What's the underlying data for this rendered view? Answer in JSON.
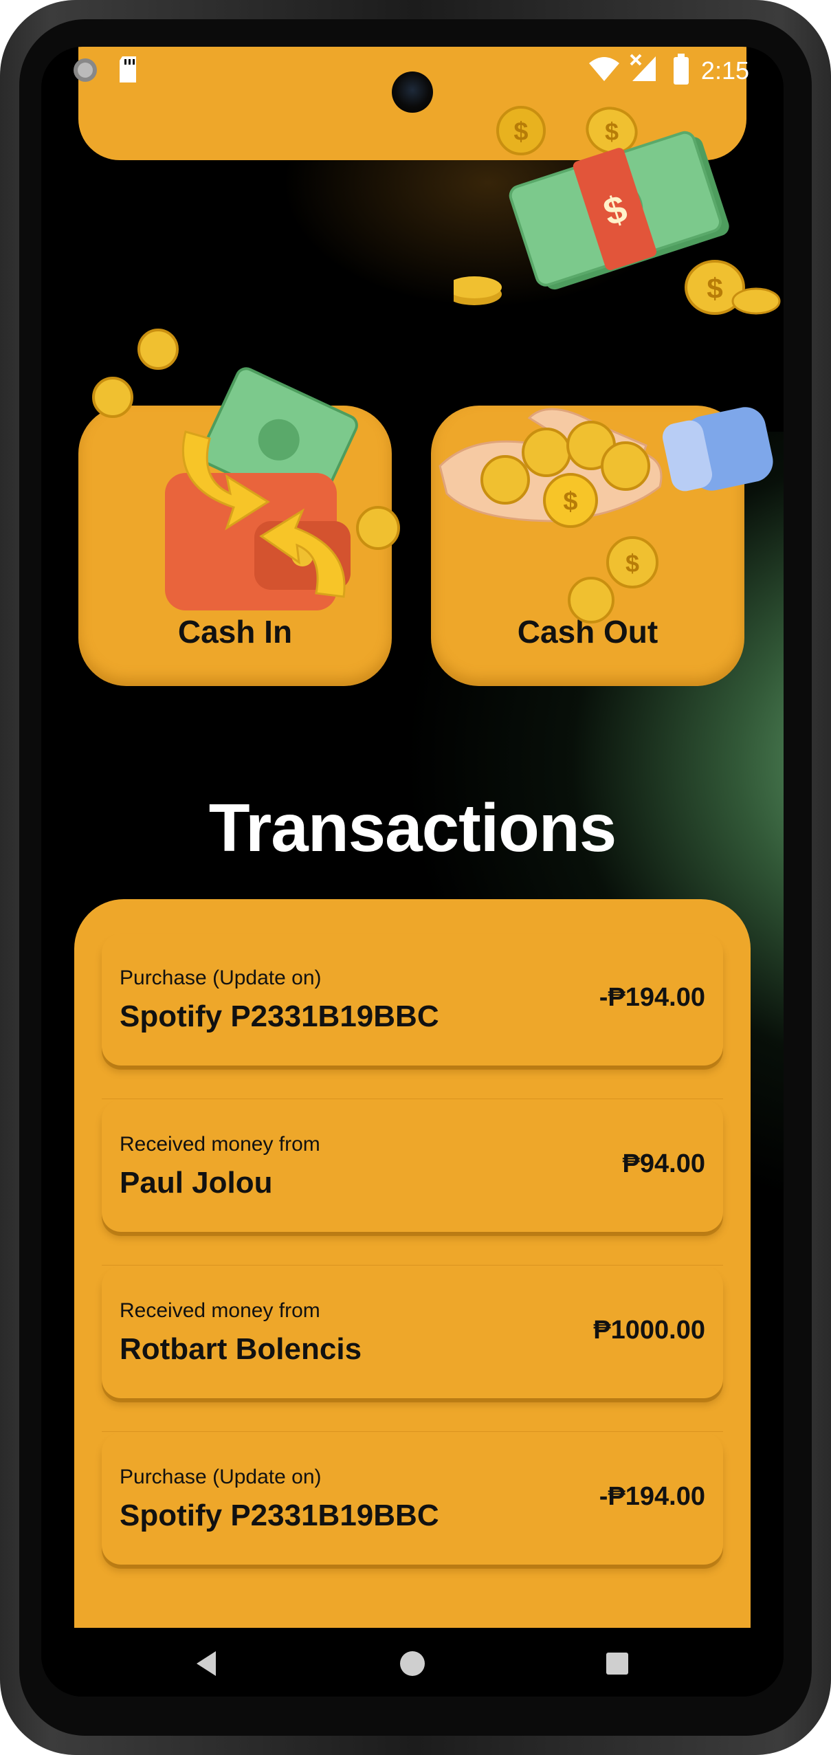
{
  "status_bar": {
    "time": "2:15"
  },
  "actions": [
    {
      "label": "Cash In",
      "icon": "wallet-icon"
    },
    {
      "label": "Cash Out",
      "icon": "coins-hand-icon"
    }
  ],
  "transactions": {
    "title": "Transactions",
    "items": [
      {
        "subtitle": "Purchase (Update on)",
        "name": "Spotify P2331B19BBC",
        "amount": "-₱194.00"
      },
      {
        "subtitle": "Received money from",
        "name": "Paul Jolou",
        "amount": "₱94.00"
      },
      {
        "subtitle": "Received money from",
        "name": "Rotbart Bolencis",
        "amount": "₱1000.00"
      },
      {
        "subtitle": "Purchase (Update on)",
        "name": "Spotify P2331B19BBC",
        "amount": "-₱194.00"
      }
    ]
  },
  "colors": {
    "accent": "#eea72a",
    "glow": "#7ac486",
    "background": "#000000"
  }
}
